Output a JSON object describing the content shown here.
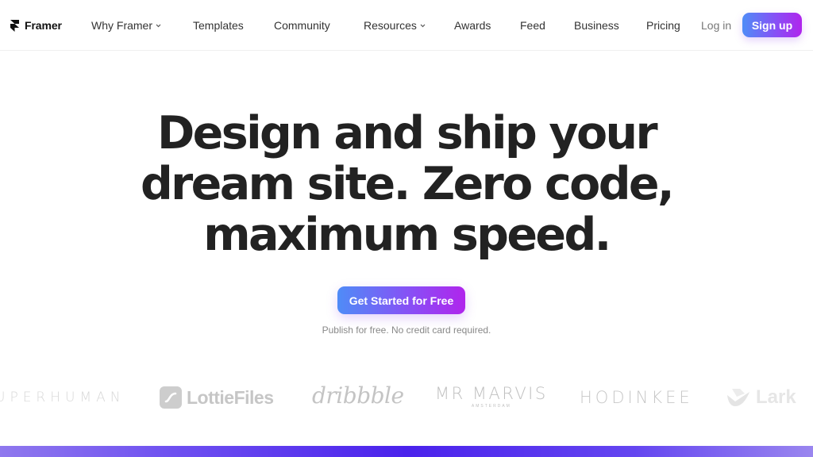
{
  "nav": {
    "brand": "Framer",
    "items": [
      {
        "label": "Why Framer",
        "has_dropdown": true
      },
      {
        "label": "Templates",
        "has_dropdown": false
      },
      {
        "label": "Community",
        "has_dropdown": false
      },
      {
        "label": "Resources",
        "has_dropdown": true
      },
      {
        "label": "Awards",
        "has_dropdown": false
      },
      {
        "label": "Feed",
        "has_dropdown": false
      },
      {
        "label": "Business",
        "has_dropdown": false
      },
      {
        "label": "Pricing",
        "has_dropdown": false
      }
    ],
    "login_label": "Log in",
    "signup_label": "Sign up"
  },
  "hero": {
    "title_lines": [
      "Design and ship your",
      "dream site. Zero code,",
      "maximum speed."
    ],
    "cta_label": "Get Started for Free",
    "subtext": "Publish for free. No credit card required."
  },
  "logos": {
    "items": [
      {
        "name": "SUPERHUMAN",
        "visible_text": "UPERHUMAN"
      },
      {
        "name": "LottieFiles",
        "visible_text": "LottieFiles"
      },
      {
        "name": "dribbble",
        "visible_text": "dribbble"
      },
      {
        "name": "MR MARVIS",
        "visible_text": "MR MARVIS",
        "subtitle": "AMSTERDAM"
      },
      {
        "name": "HODINKEE",
        "visible_text": "HODINKEE"
      },
      {
        "name": "Lark",
        "visible_text": "Lark"
      }
    ]
  },
  "colors": {
    "accent_gradient_start": "#4f8cf7",
    "accent_gradient_end": "#b025ec",
    "text_primary": "#222222",
    "text_muted": "#888888",
    "band_color": "#4a22ec"
  }
}
